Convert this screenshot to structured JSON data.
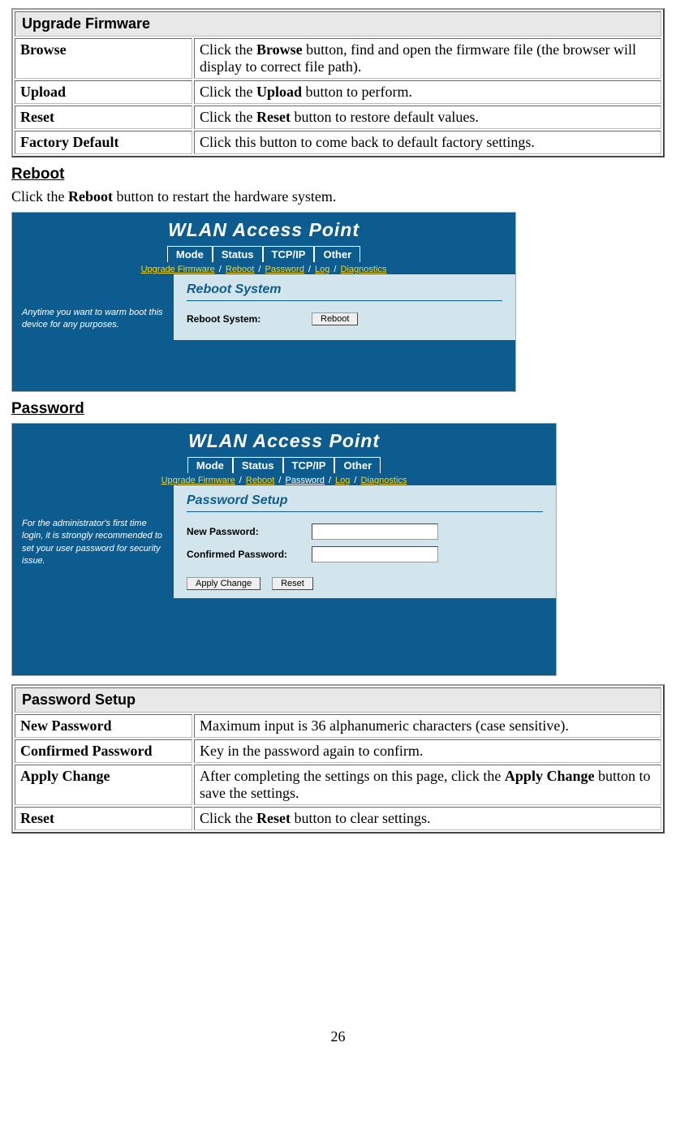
{
  "upgrade_firmware": {
    "title": "Upgrade Firmware",
    "rows": [
      {
        "label": "Browse",
        "desc_pre": "Click the ",
        "bold": "Browse",
        "desc_post": " button, find and open the firmware file (the browser will display to correct file path)."
      },
      {
        "label": "Upload",
        "desc_pre": "Click the ",
        "bold": "Upload",
        "desc_post": " button to perform."
      },
      {
        "label": "Reset",
        "desc_pre": "Click the ",
        "bold": "Reset",
        "desc_post": " button to restore default values."
      },
      {
        "label": "Factory Default",
        "desc_pre": "",
        "bold": "",
        "desc_post": "Click this button to come back to default factory settings."
      }
    ]
  },
  "reboot": {
    "heading": "Reboot",
    "body_pre": "Click the ",
    "body_bold": "Reboot",
    "body_post": " button to restart the hardware system.",
    "screenshot": {
      "title": "WLAN Access Point",
      "tabs": [
        "Mode",
        "Status",
        "TCP/IP",
        "Other"
      ],
      "subnav": [
        "Upgrade Firmware",
        "Reboot",
        "Password",
        "Log",
        "Diagnostics"
      ],
      "active_subnav": "Reboot",
      "sidebar_text": "Anytime you want to warm boot this device for any purposes.",
      "panel_title": "Reboot System",
      "label": "Reboot System:",
      "button": "Reboot"
    }
  },
  "password": {
    "heading": "Password",
    "screenshot": {
      "title": "WLAN Access Point",
      "tabs": [
        "Mode",
        "Status",
        "TCP/IP",
        "Other"
      ],
      "subnav": [
        "Upgrade Firmware",
        "Reboot",
        "Password",
        "Log",
        "Diagnostics"
      ],
      "active_subnav": "Password",
      "sidebar_text": "For the administrator's first time login, it is strongly recommended to set your user password for security issue.",
      "panel_title": "Password Setup",
      "label_new": "New Password:",
      "label_confirm": "Confirmed Password:",
      "btn_apply": "Apply Change",
      "btn_reset": "Reset"
    }
  },
  "password_setup": {
    "title": "Password Setup",
    "rows": [
      {
        "label": "New Password",
        "desc_pre": "",
        "bold": "",
        "desc_post": "Maximum input is 36 alphanumeric characters (case sensitive)."
      },
      {
        "label": "Confirmed Password",
        "desc_pre": "",
        "bold": "",
        "desc_post": "Key in the password again to confirm."
      },
      {
        "label": "Apply Change",
        "desc_pre": "After completing the settings on this page, click the ",
        "bold": "Apply Change",
        "desc_post": " button to save the settings."
      },
      {
        "label": "Reset",
        "desc_pre": "Click the ",
        "bold": "Reset",
        "desc_post": " button to clear settings."
      }
    ]
  },
  "page_number": "26"
}
